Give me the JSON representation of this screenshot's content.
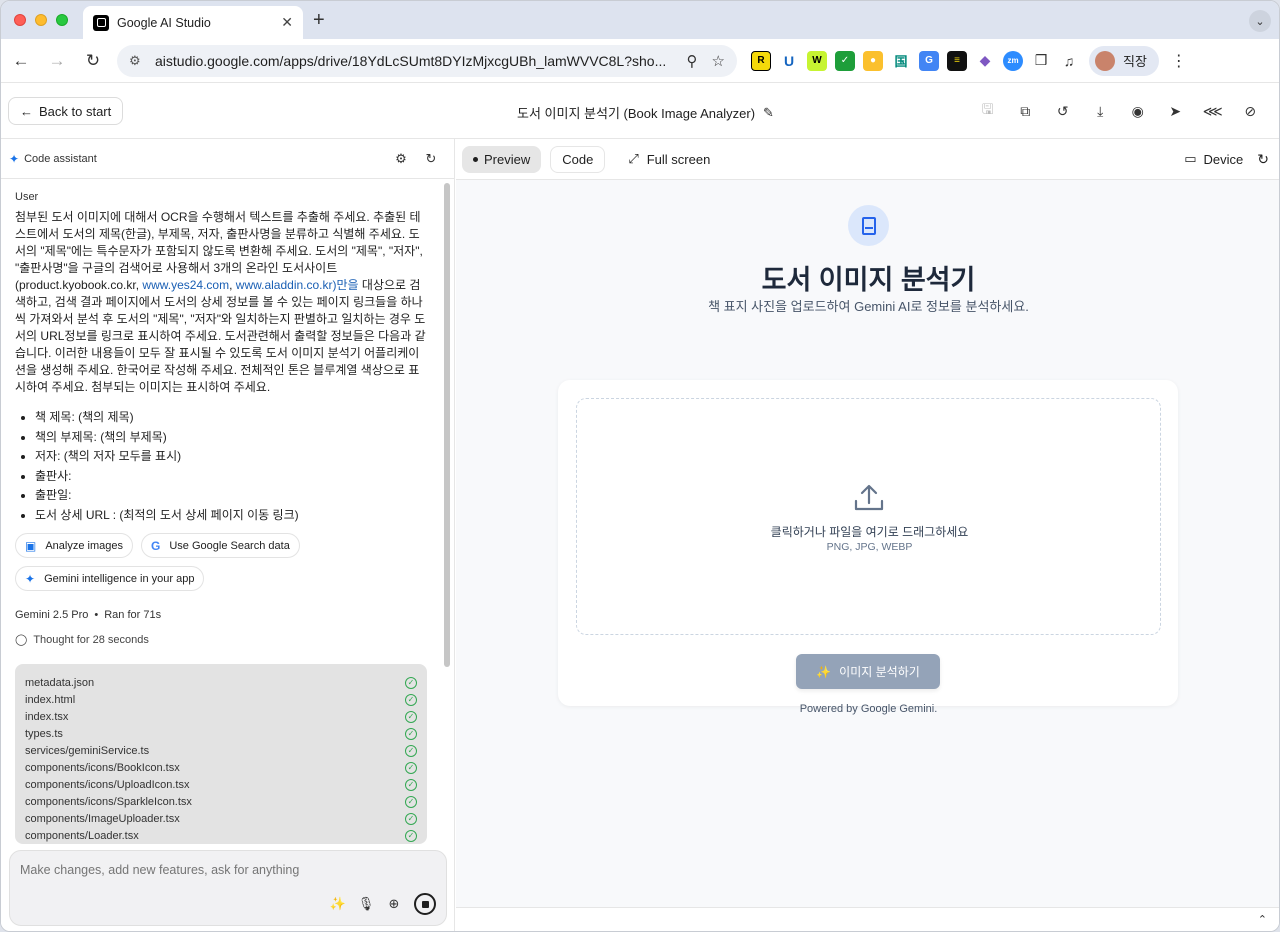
{
  "browser": {
    "tab_title": "Google AI Studio",
    "tab_close": "✕",
    "new_tab": "+",
    "url": "aistudio.google.com/apps/drive/18YdLcSUmt8DYIzMjxcgUBh_lamWVVC8L?sho...",
    "profile_name": "직장"
  },
  "appbar": {
    "back_label": "Back to start",
    "title": "도서 이미지 분석기 (Book Image Analyzer)"
  },
  "left": {
    "header_title": "Code assistant",
    "user_label": "User",
    "prompt": {
      "part1": "첨부된 도서 이미지에 대해서 OCR을 수행해서 텍스트를 추출해 주세요. 추출된 테스트에서 도서의 제목(한글), 부제목, 저자, 출판사명을 분류하고 식별해 주세요. 도서의 \"제목\"에는 특수문자가 포함되지 않도록 변환해 주세요. 도서의 \"제목\", \"저자\", \"출판사명\"을 구글의 검색어로 사용해서 3개의 온라인 도서사이트(product.kyobook.co.kr,",
      "link1": "www.yes24.com",
      "sep": ", ",
      "link2": "www.aladdin.co.kr)만을",
      "part2": " 대상으로 검색하고, 검색 결과 페이지에서 도서의 상세 정보를 볼 수 있는 페이지 링크들을 하나씩 가져와서 분석 후 도서의 \"제목\", \"저자\"와 일치하는지 판별하고 일치하는 경우 도서의 URL정보를 링크로 표시하여 주세요. 도서관련해서 출력할 정보들은 다음과 같습니다. 이러한 내용들이 모두 잘 표시될 수 있도록 도서 이미지 분석기 어플리케이션을 생성해 주세요. 한국어로 작성해 주세요. 전체적인 톤은 블루계열 색상으로 표시하여 주세요. 첨부되는 이미지는 표시하여 주세요."
    },
    "bullets": [
      "책 제목: (책의 제목)",
      "책의 부제목: (책의 부제목)",
      "저자: (책의 저자 모두를 표시)",
      "출판사:",
      "출판일:",
      "도서 상세 URL : (최적의 도서 상세 페이지 이동 링크)"
    ],
    "chips": [
      {
        "label": "Analyze images",
        "icon": "image-scan-icon"
      },
      {
        "label": "Use Google Search data",
        "icon": "google-icon"
      },
      {
        "label": "Gemini intelligence in your app",
        "icon": "sparkle-icon"
      }
    ],
    "model": "Gemini 2.5 Pro",
    "ran_for": "Ran for 71s",
    "thought": "Thought for 28 seconds",
    "files": [
      "metadata.json",
      "index.html",
      "index.tsx",
      "types.ts",
      "services/geminiService.ts",
      "components/icons/BookIcon.tsx",
      "components/icons/UploadIcon.tsx",
      "components/icons/SparkleIcon.tsx",
      "components/ImageUploader.tsx",
      "components/Loader.tsx"
    ],
    "composer_placeholder": "Make changes, add new features, ask for anything"
  },
  "right": {
    "tabs": {
      "preview": "Preview",
      "code": "Code"
    },
    "fullscreen": "Full screen",
    "device": "Device",
    "app": {
      "title": "도서 이미지 분석기",
      "subtitle": "책 표지 사진을 업로드하여 Gemini AI로 정보를 분석하세요.",
      "drop_text": "클릭하거나 파일을 여기로 드래그하세요",
      "drop_types": "PNG, JPG, WEBP",
      "analyze_button": "이미지 분석하기",
      "powered": "Powered by Google Gemini."
    }
  },
  "colors": {
    "accent": "#1a73e8",
    "link": "#1a5fb4",
    "button_disabled": "#94a3b8",
    "book_icon": "#2563eb"
  }
}
